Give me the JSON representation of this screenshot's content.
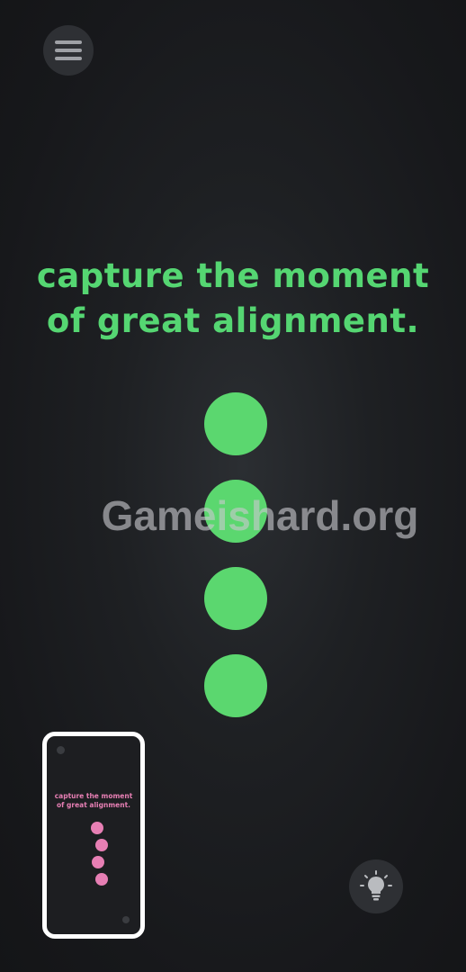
{
  "level": {
    "title_line1": "capture the moment",
    "title_line2": "of great alignment.",
    "dot_color": "#5bd76f",
    "dot_count": 4
  },
  "preview": {
    "title_line1": "capture the moment",
    "title_line2": "of great alignment.",
    "dot_color": "#e77fb4",
    "dot_count": 4
  },
  "watermark": {
    "text": "Gameishard.org"
  },
  "icons": {
    "menu": "hamburger-menu-icon",
    "hint": "lightbulb-icon"
  },
  "colors": {
    "background": "#1c1e21",
    "accent_green": "#55d672",
    "accent_pink": "#e77fb4",
    "button_bg": "#2e3034"
  }
}
